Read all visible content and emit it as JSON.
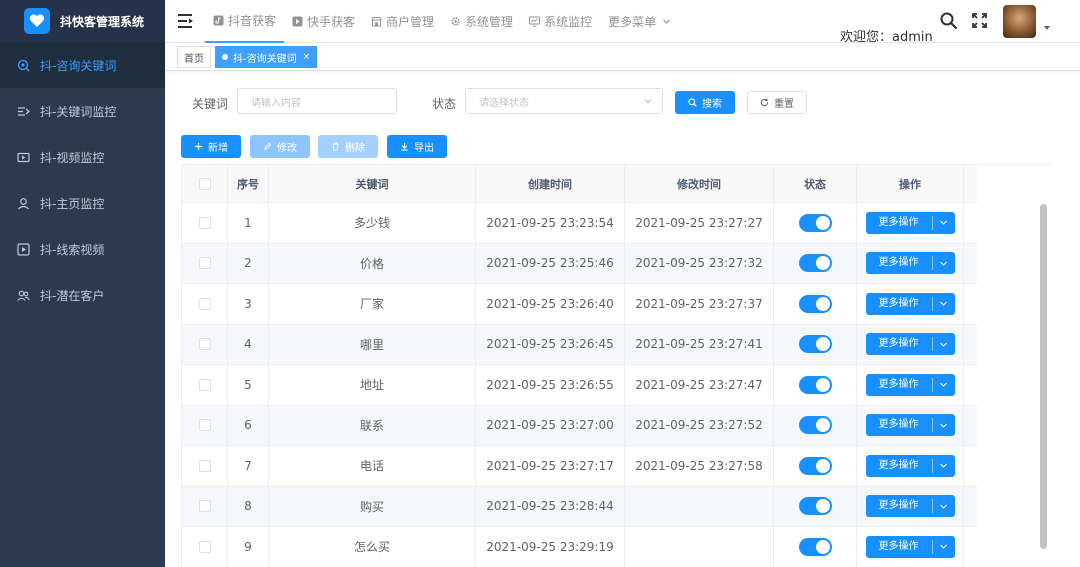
{
  "brand": {
    "title": "抖快客管理系统"
  },
  "sidebar": {
    "items": [
      {
        "label": "抖-咨询关键词",
        "icon": "consult-icon",
        "active": true
      },
      {
        "label": "抖-关键词监控",
        "icon": "keyword-icon",
        "active": false
      },
      {
        "label": "抖-视频监控",
        "icon": "video-icon",
        "active": false
      },
      {
        "label": "抖-主页监控",
        "icon": "user-icon",
        "active": false
      },
      {
        "label": "抖-线索视频",
        "icon": "play-icon",
        "active": false
      },
      {
        "label": "抖-潜在客户",
        "icon": "customers-icon",
        "active": false
      }
    ]
  },
  "topnav": {
    "items": [
      {
        "label": "抖音获客",
        "icon": "tiktok-icon",
        "active": true
      },
      {
        "label": "快手获客",
        "icon": "kuaishou-icon",
        "active": false
      },
      {
        "label": "商户管理",
        "icon": "merchant-icon",
        "active": false
      },
      {
        "label": "系统管理",
        "icon": "settings-icon",
        "active": false
      },
      {
        "label": "系统监控",
        "icon": "monitor-icon",
        "active": false
      },
      {
        "label": "更多菜单",
        "icon": "chevron-down-icon",
        "active": false
      }
    ]
  },
  "header": {
    "welcome": "欢迎您：admin"
  },
  "tags": {
    "home": "首页",
    "current": "抖-咨询关键词",
    "close": "×"
  },
  "search": {
    "keyword_label": "关键词",
    "keyword_placeholder": "请输入内容",
    "status_label": "状态",
    "status_placeholder": "请选择状态",
    "search_button": "搜索",
    "reset_button": "重置"
  },
  "toolbar": {
    "add": "新增",
    "edit": "修改",
    "delete": "删除",
    "export": "导出"
  },
  "table": {
    "columns": [
      "序号",
      "关键词",
      "创建时间",
      "修改时间",
      "状态",
      "操作"
    ],
    "op_label": "更多操作",
    "rows": [
      {
        "no": "1",
        "keyword": "多少钱",
        "created": "2021-09-25 23:23:54",
        "modified": "2021-09-25 23:27:27",
        "status": true
      },
      {
        "no": "2",
        "keyword": "价格",
        "created": "2021-09-25 23:25:46",
        "modified": "2021-09-25 23:27:32",
        "status": true
      },
      {
        "no": "3",
        "keyword": "厂家",
        "created": "2021-09-25 23:26:40",
        "modified": "2021-09-25 23:27:37",
        "status": true
      },
      {
        "no": "4",
        "keyword": "哪里",
        "created": "2021-09-25 23:26:45",
        "modified": "2021-09-25 23:27:41",
        "status": true
      },
      {
        "no": "5",
        "keyword": "地址",
        "created": "2021-09-25 23:26:55",
        "modified": "2021-09-25 23:27:47",
        "status": true
      },
      {
        "no": "6",
        "keyword": "联系",
        "created": "2021-09-25 23:27:00",
        "modified": "2021-09-25 23:27:52",
        "status": true
      },
      {
        "no": "7",
        "keyword": "电话",
        "created": "2021-09-25 23:27:17",
        "modified": "2021-09-25 23:27:58",
        "status": true
      },
      {
        "no": "8",
        "keyword": "购买",
        "created": "2021-09-25 23:28:44",
        "modified": "",
        "status": true
      },
      {
        "no": "9",
        "keyword": "怎么买",
        "created": "2021-09-25 23:29:19",
        "modified": "",
        "status": true
      }
    ]
  }
}
